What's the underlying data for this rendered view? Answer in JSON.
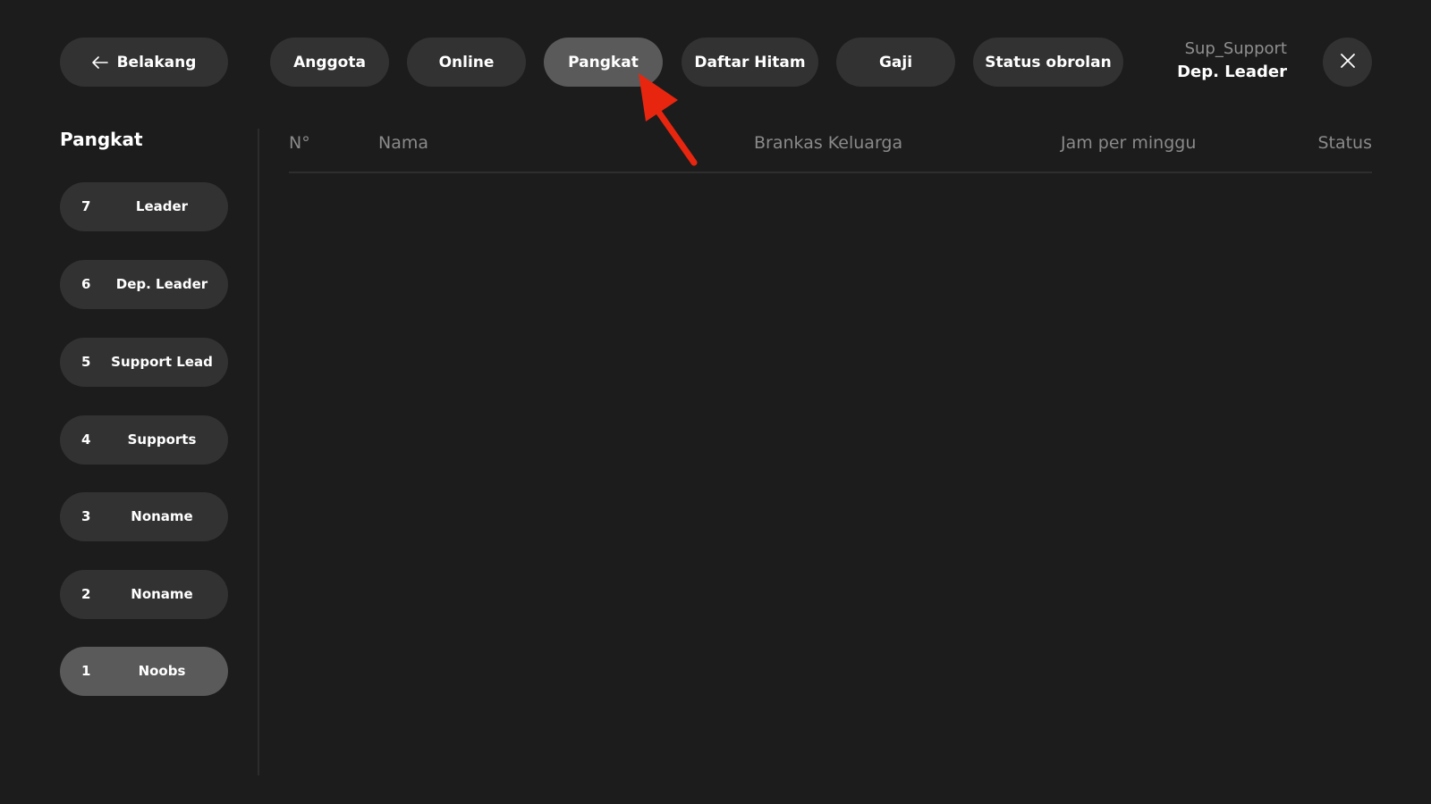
{
  "header": {
    "back_label": "Belakang",
    "tabs": [
      {
        "label": "Anggota",
        "active": false
      },
      {
        "label": "Online",
        "active": false
      },
      {
        "label": "Pangkat",
        "active": true
      },
      {
        "label": "Daftar Hitam",
        "active": false
      },
      {
        "label": "Gaji",
        "active": false
      },
      {
        "label": "Status obrolan",
        "active": false
      }
    ],
    "user": {
      "name": "Sup_Support",
      "rank": "Dep. Leader"
    },
    "close_icon": "close-icon",
    "back_icon": "arrow-left-icon"
  },
  "sidebar": {
    "title": "Pangkat",
    "ranks": [
      {
        "number": "7",
        "label": "Leader",
        "active": false
      },
      {
        "number": "6",
        "label": "Dep. Leader",
        "active": false
      },
      {
        "number": "5",
        "label": "Support Lead",
        "active": false
      },
      {
        "number": "4",
        "label": "Supports",
        "active": false
      },
      {
        "number": "3",
        "label": "Noname",
        "active": false
      },
      {
        "number": "2",
        "label": "Noname",
        "active": false
      },
      {
        "number": "1",
        "label": "Noobs",
        "active": true
      }
    ]
  },
  "table": {
    "columns": [
      "N°",
      "Nama",
      "Brankas Keluarga",
      "Jam per minggu",
      "Status"
    ],
    "rows": []
  },
  "colors": {
    "background": "#1c1c1c",
    "pill": "#323232",
    "pill_active": "#5a5a5a",
    "annotation_arrow": "#e8260f"
  }
}
